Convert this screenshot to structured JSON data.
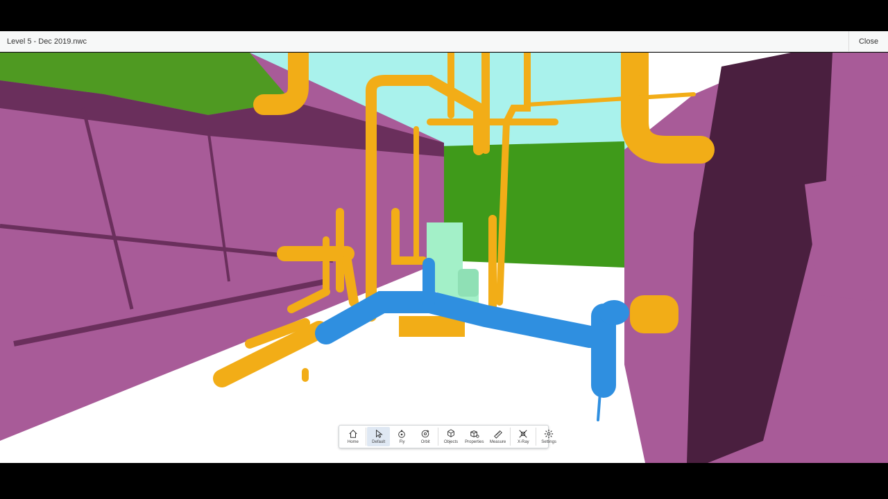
{
  "window": {
    "title": "Level 5 - Dec 2019.nwc",
    "close_label": "Close"
  },
  "toolbar": {
    "active": "Default",
    "tools": [
      {
        "label": "Home",
        "icon": "home-icon"
      },
      {
        "label": "Default",
        "icon": "pointer-icon"
      },
      {
        "label": "Fly",
        "icon": "fly-icon"
      },
      {
        "label": "Orbit",
        "icon": "orbit-icon"
      },
      {
        "label": "Objects",
        "icon": "cubes-icon"
      },
      {
        "label": "Properties",
        "icon": "properties-icon"
      },
      {
        "label": "Measure",
        "icon": "ruler-icon"
      },
      {
        "label": "X-Ray",
        "icon": "xray-icon"
      },
      {
        "label": "Settings",
        "icon": "gear-icon"
      }
    ]
  },
  "colors": {
    "wall": "#a85b98",
    "wall_dark": "#4a1f3f",
    "pipe": "#f2ad17",
    "blue_pipe": "#2f8fe0",
    "green_wall": "#3f9a1a",
    "sky": "#a9f2ec",
    "equipment": "#a3f0c8"
  }
}
